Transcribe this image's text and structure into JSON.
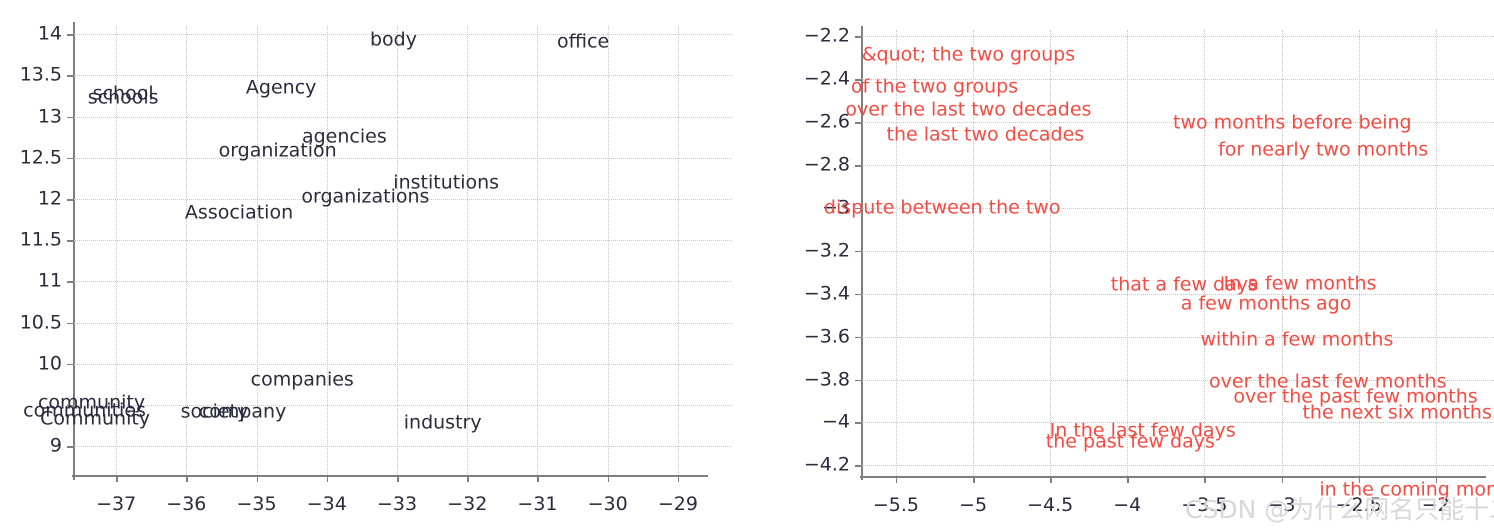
{
  "watermark": {
    "text": "CSDN @为什么网名只能十二个字i",
    "color": "#d8d8d8"
  },
  "colors": {
    "left_word": "#2b2b3d",
    "right_word": "#f54b42",
    "axis": "#7f7f7f",
    "grid": "#c8c8c8"
  },
  "chart_data": [
    {
      "type": "scatter",
      "title": "",
      "xlabel": "",
      "ylabel": "",
      "grid": true,
      "legend": "none",
      "xlim": [
        -37.6,
        -28.6
      ],
      "ylim": [
        8.65,
        14.1
      ],
      "xticks": [
        -37,
        -36,
        -35,
        -34,
        -33,
        -32,
        -31,
        -30,
        -29
      ],
      "xtick_labels": [
        "−37",
        "−36",
        "−35",
        "−34",
        "−33",
        "−32",
        "−31",
        "−30",
        "−29"
      ],
      "yticks": [
        9,
        9.5,
        10,
        10.5,
        11,
        11.5,
        12,
        12.5,
        13,
        13.5,
        14
      ],
      "ytick_labels": [
        "9",
        "",
        "10",
        "10.5",
        "11",
        "11.5",
        "12",
        "12.5",
        "13",
        "13.5",
        "14"
      ],
      "ytick_labels_shown": [
        "9",
        "10",
        "10.5",
        "11",
        "11.5",
        "12",
        "12.5",
        "13",
        "13.5",
        "14"
      ],
      "point_labels": [
        {
          "text": "body",
          "x": -33.05,
          "y": 13.93
        },
        {
          "text": "office",
          "x": -30.35,
          "y": 13.9
        },
        {
          "text": "school",
          "x": -36.9,
          "y": 13.28
        },
        {
          "text": "schools",
          "x": -36.9,
          "y": 13.22
        },
        {
          "text": "Agency",
          "x": -34.65,
          "y": 13.35
        },
        {
          "text": "agencies",
          "x": -33.75,
          "y": 12.75
        },
        {
          "text": "organization",
          "x": -34.7,
          "y": 12.58
        },
        {
          "text": "institutions",
          "x": -32.3,
          "y": 12.2
        },
        {
          "text": "organizations",
          "x": -33.45,
          "y": 12.03
        },
        {
          "text": "Association",
          "x": -35.25,
          "y": 11.83
        },
        {
          "text": "companies",
          "x": -34.35,
          "y": 9.8
        },
        {
          "text": "community",
          "x": -37.35,
          "y": 9.53
        },
        {
          "text": "communities",
          "x": -37.45,
          "y": 9.43
        },
        {
          "text": "Community",
          "x": -37.3,
          "y": 9.33
        },
        {
          "text": "society",
          "x": -35.6,
          "y": 9.42
        },
        {
          "text": "company",
          "x": -35.2,
          "y": 9.42
        },
        {
          "text": "industry",
          "x": -32.35,
          "y": 9.28
        }
      ]
    },
    {
      "type": "scatter",
      "title": "",
      "xlabel": "",
      "ylabel": "",
      "grid": true,
      "legend": "none",
      "xlim": [
        -5.72,
        -1.7
      ],
      "ylim": [
        -4.25,
        -2.17
      ],
      "xticks": [
        -5.5,
        -5,
        -4.5,
        -4,
        -3.5,
        -3,
        -2.5,
        -2
      ],
      "xtick_labels": [
        "−5.5",
        "−5",
        "−4.5",
        "−4",
        "−3.5",
        "−3",
        "−2.5",
        "−2"
      ],
      "yticks": [
        -4.2,
        -4,
        -3.8,
        -3.6,
        -3.4,
        -3.2,
        -3,
        -2.8,
        -2.6,
        -2.4,
        -2.2
      ],
      "ytick_labels": [
        "−4.2",
        "−4",
        "−3.8",
        "−3.6",
        "−3.4",
        "−3.2",
        "−3",
        "−2.8",
        "−2.6",
        "−2.4",
        "−2.2"
      ],
      "point_labels": [
        {
          "text": "&quot; the two groups",
          "x": -5.03,
          "y": -2.285
        },
        {
          "text": "of the two groups",
          "x": -5.25,
          "y": -2.435
        },
        {
          "text": "over the last two decades",
          "x": -5.03,
          "y": -2.545
        },
        {
          "text": "the last two decades",
          "x": -4.92,
          "y": -2.66
        },
        {
          "text": "two months before being",
          "x": -2.93,
          "y": -2.605
        },
        {
          "text": "for nearly two months",
          "x": -2.73,
          "y": -2.73
        },
        {
          "text": "dispute between the two",
          "x": -5.2,
          "y": -3.0
        },
        {
          "text": "that a few days",
          "x": -3.63,
          "y": -3.36
        },
        {
          "text": "In a few months",
          "x": -2.88,
          "y": -3.355
        },
        {
          "text": "a few months ago",
          "x": -3.1,
          "y": -3.45
        },
        {
          "text": "within a few months",
          "x": -2.9,
          "y": -3.615
        },
        {
          "text": "over the last few months",
          "x": -2.7,
          "y": -3.81
        },
        {
          "text": "over the past few months",
          "x": -2.52,
          "y": -3.88
        },
        {
          "text": "the next six months",
          "x": -2.25,
          "y": -3.955
        },
        {
          "text": "In the last few days",
          "x": -3.9,
          "y": -4.04
        },
        {
          "text": "the past few days",
          "x": -3.98,
          "y": -4.09
        },
        {
          "text": "in the coming months",
          "x": -2.08,
          "y": -4.315
        }
      ]
    }
  ]
}
